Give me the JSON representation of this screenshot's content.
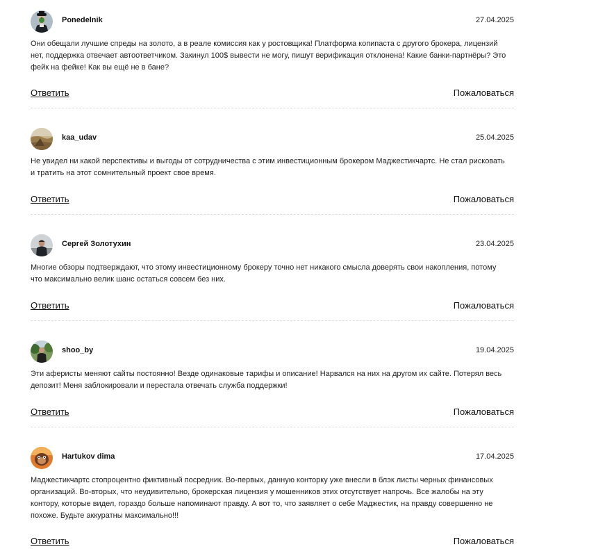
{
  "comments": [
    {
      "author": "Ponedelnik",
      "date": "27.04.2025",
      "avatar_icon": "magritte-apple-face",
      "text": "Они обещали лучшие спреды на золото, а в реале комиссия как у ростовщика! Платформа копипаста с другого брокера, лицензий нет, поддержка отвечает автоответчиком. Закинул 100$ вывести не могу, пишут верификация отклонена! Какие банки-партнёры? Это фейк на фейке! Как вы ещё не в бане?",
      "reply_label": "Ответить",
      "report_label": "Пожаловаться"
    },
    {
      "author": "kaa_udav",
      "date": "25.04.2025",
      "avatar_icon": "landscape-photo",
      "text": "Не увидел ни какой перспективы и выгоды от сотрудничества с этим инвестиционным брокером Маджестикчартс. Не стал рисковать и тратить на этот сомнительный проект свое время.",
      "reply_label": "Ответить",
      "report_label": "Пожаловаться"
    },
    {
      "author": "Сергей Золотухин",
      "date": "23.04.2025",
      "avatar_icon": "person-in-dark-jacket",
      "text": "Многие обзоры подтверждают, что этому инвестиционному брокеру точно нет никакого смысла доверять свои накопления, потому что максимально велик шанс остаться совсем без них.",
      "reply_label": "Ответить",
      "report_label": "Пожаловаться"
    },
    {
      "author": "shoo_by",
      "date": "19.04.2025",
      "avatar_icon": "person-outdoors-trees",
      "text": "Эти аферисты меняют сайты постоянно! Везде одинаковые тарифы и описание! Нарвался на них на другом их сайте. Потерял весь депозит! Меня заблокировали и перестала отвечать служба поддержки!",
      "reply_label": "Ответить",
      "report_label": "Пожаловаться"
    },
    {
      "author": "Hartukov dima",
      "date": "17.04.2025",
      "avatar_icon": "cartoon-character",
      "text": "Маджестикчартс стопроцентно фиктивный посредник. Во-первых, данную конторку уже внесли в блэк листы черных финансовых организаций. Во-вторых, что неудивительно, брокерская лицензия у мошенников этих отсутствует напрочь. Все жалобы на эту контору, которые видел, гораздо больше напоминают правду. А вот то, что заявляет о себе Маджестик, на правду совершенно не похоже. Будьте аккуратны максимально!!!",
      "reply_label": "Ответить",
      "report_label": "Пожаловаться"
    }
  ]
}
